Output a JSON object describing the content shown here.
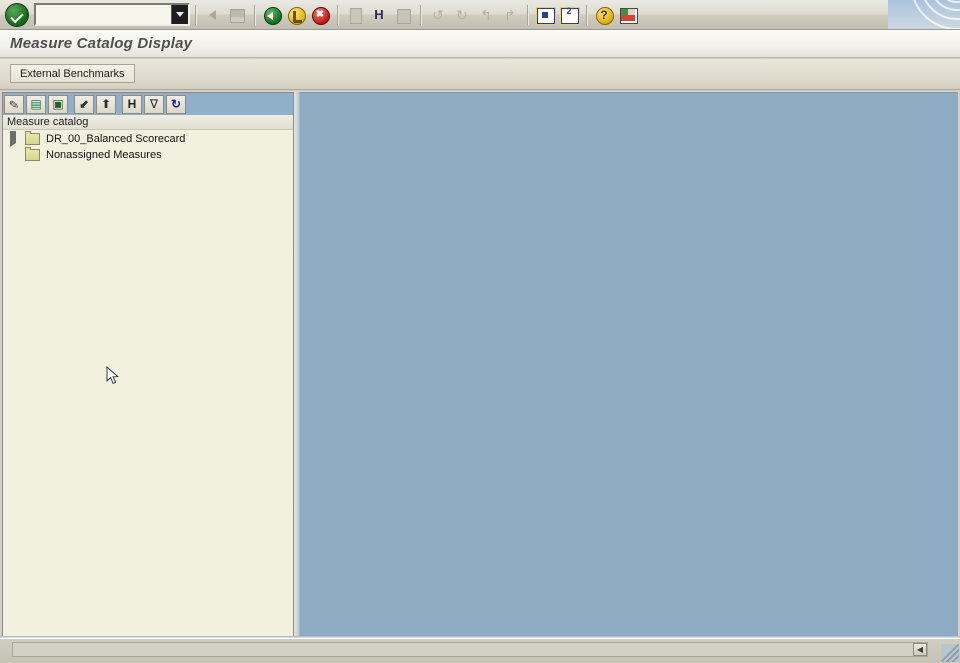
{
  "window": {
    "title": "Measure Catalog Display"
  },
  "system_toolbar": {
    "command_field": {
      "value": "",
      "placeholder": "",
      "dropdown_icon": "chevron-down-icon"
    },
    "enter_button_label": "",
    "buttons": [
      {
        "name": "back-button",
        "icon": "green-back-arrow-icon",
        "enabled": true
      },
      {
        "name": "exit-button",
        "icon": "yellow-exit-icon",
        "enabled": true
      },
      {
        "name": "cancel-button",
        "icon": "red-cancel-icon",
        "enabled": true
      },
      {
        "name": "print-button",
        "icon": "print-document-icon",
        "enabled": false
      },
      {
        "name": "find-button",
        "icon": "find-binoculars-icon",
        "enabled": true
      },
      {
        "name": "find-next-button",
        "icon": "find-next-icon",
        "enabled": false
      },
      {
        "name": "first-page-button",
        "icon": "first-page-icon",
        "enabled": false
      },
      {
        "name": "previous-page-button",
        "icon": "previous-page-icon",
        "enabled": false
      },
      {
        "name": "next-page-button",
        "icon": "next-page-icon",
        "enabled": false
      },
      {
        "name": "last-page-button",
        "icon": "last-page-icon",
        "enabled": false
      },
      {
        "name": "create-session-button",
        "icon": "new-window-icon",
        "enabled": true
      },
      {
        "name": "create-shortcut-button",
        "icon": "shortcut-window-icon",
        "enabled": true
      },
      {
        "name": "help-button",
        "icon": "help-question-icon",
        "enabled": true
      },
      {
        "name": "layout-menu-button",
        "icon": "customize-layout-icon",
        "enabled": true
      }
    ]
  },
  "tabstrip": {
    "tabs": [
      {
        "label": "External Benchmarks",
        "selected": true
      }
    ]
  },
  "tree_panel": {
    "toolbar": [
      {
        "name": "tree-edit-button",
        "icon": "pencil-icon",
        "glyph": "✎"
      },
      {
        "name": "tree-display-button",
        "icon": "card-icon",
        "glyph": "▤"
      },
      {
        "name": "tree-save-button",
        "icon": "disk-icon",
        "glyph": "▣"
      },
      {
        "name": "tree-expand-button",
        "icon": "expand-all-icon",
        "glyph": "⬋"
      },
      {
        "name": "tree-collapse-button",
        "icon": "collapse-all-icon",
        "glyph": "⬆"
      },
      {
        "name": "tree-find-button",
        "icon": "binoculars-icon",
        "glyph": "H"
      },
      {
        "name": "tree-filter-button",
        "icon": "filter-icon",
        "glyph": "∇"
      },
      {
        "name": "tree-refresh-button",
        "icon": "refresh-icon",
        "glyph": "↻"
      }
    ],
    "header": "Measure catalog",
    "nodes": [
      {
        "label": "DR_00_Balanced Scorecard",
        "expandable": true,
        "expanded": false,
        "icon": "folder-icon"
      },
      {
        "label": "Nonassigned Measures",
        "expandable": false,
        "expanded": false,
        "icon": "folder-icon"
      }
    ]
  },
  "main_panel": {
    "content": ""
  },
  "status_bar": {
    "horizontal_scrollbar": {
      "thumb_glyph": "◀"
    },
    "resize_grip": "resize-grip-icon"
  },
  "colors": {
    "main_panel_bg": "#8dabc2",
    "tree_panel_bg": "#f2f1e0",
    "tree_toolbar_bg": "#8fb0c8",
    "title_text": "#4f4f50",
    "folder_fill": "#e2dfa0"
  }
}
